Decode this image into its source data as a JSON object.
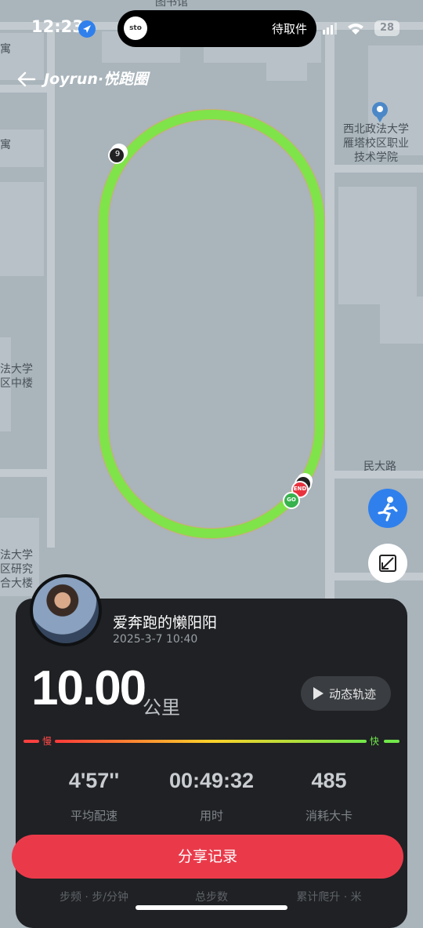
{
  "status_bar": {
    "time": "12:23",
    "island_text": "待取件",
    "island_logo": "sto",
    "battery": "28"
  },
  "header": {
    "brand": "Joyrun·悦跑圈",
    "back_icon": "back-arrow-icon"
  },
  "map": {
    "labels": {
      "top_cut": "图书馆",
      "left_1": "寓",
      "left_2": "寓",
      "poi_name": "西北政法大学\n雁塔校区职业\n技术学院",
      "left_mid": "法大学\n区中楼",
      "left_bottom": "法大学\n区研究\n合大楼",
      "road": "民大路"
    },
    "markers": {
      "lap": "9",
      "end": "END",
      "go": "GO"
    },
    "buttons": {
      "run_icon": "runner-icon",
      "fullscreen_icon": "expand-icon"
    }
  },
  "record": {
    "username": "爱奔跑的懒阳阳",
    "datetime": "2025-3-7 10:40",
    "distance": "10.00",
    "unit": "公里",
    "replay_label": "动态轨迹",
    "speed_slow": "慢",
    "speed_fast": "快",
    "stats": [
      {
        "value": "4'57''",
        "label": "平均配速"
      },
      {
        "value": "00:49:32",
        "label": "用时"
      },
      {
        "value": "485",
        "label": "消耗大卡"
      }
    ],
    "lower_labels": [
      "步频 · 步/分钟",
      "总步数",
      "累计爬升 · 米"
    ],
    "share_label": "分享记录"
  },
  "colors": {
    "track": "#7fe34a",
    "share_button": "#ea3a4a",
    "card_bg": "#1f2124",
    "accent_blue": "#2f80ed"
  }
}
